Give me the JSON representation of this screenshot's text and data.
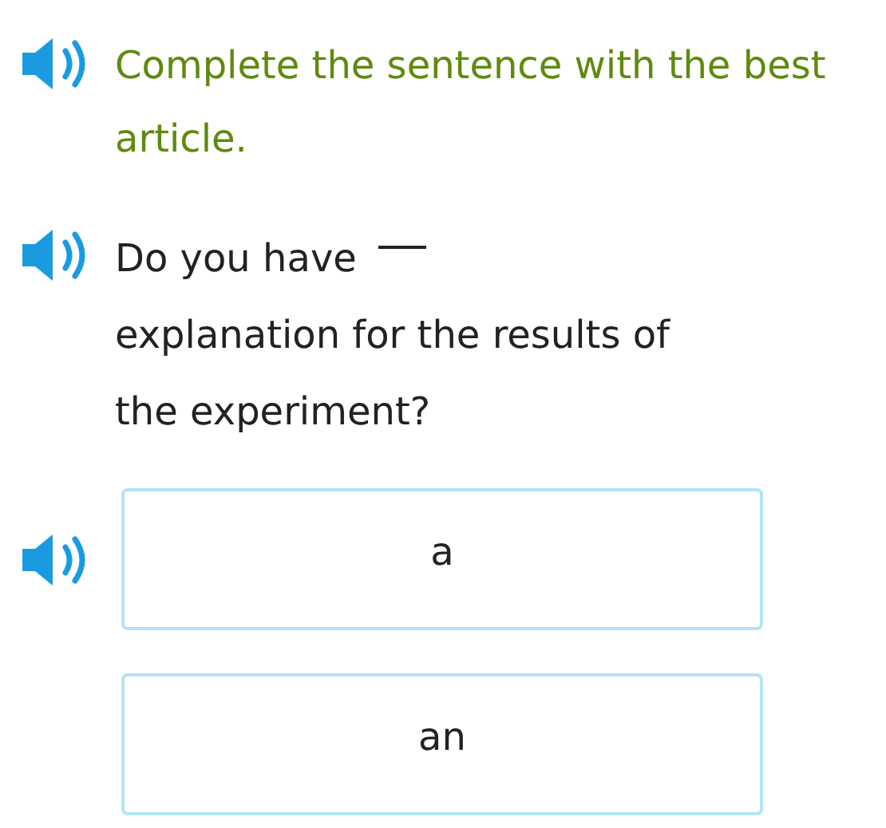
{
  "instruction": {
    "text": "Complete the sentence with the best article.",
    "audio": true
  },
  "question": {
    "before": "Do you have",
    "blank": true,
    "after": "explanation for the results of the experiment?",
    "audio": true
  },
  "choices": [
    {
      "label": "a",
      "selected": false,
      "audio": true
    },
    {
      "label": "an",
      "selected": false,
      "audio": false
    }
  ]
}
